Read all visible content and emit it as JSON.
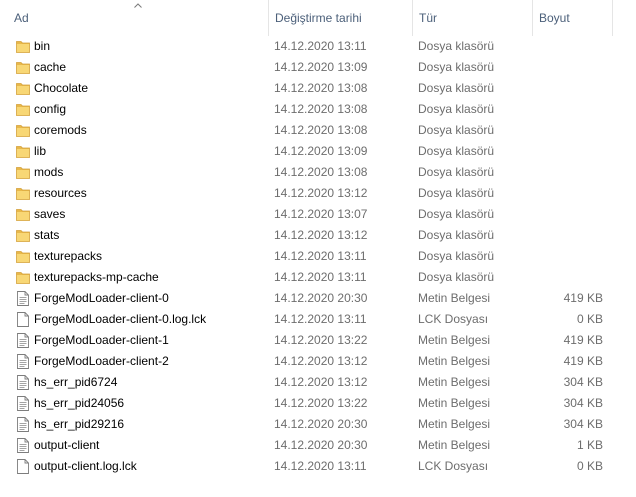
{
  "columns": {
    "name": "Ad",
    "date": "Değiştirme tarihi",
    "type": "Tür",
    "size": "Boyut"
  },
  "sort_icon": "chevron-up-icon",
  "files": [
    {
      "name": "bin",
      "date": "14.12.2020 13:11",
      "type": "Dosya klasörü",
      "size": "",
      "icon": "folder-icon"
    },
    {
      "name": "cache",
      "date": "14.12.2020 13:09",
      "type": "Dosya klasörü",
      "size": "",
      "icon": "folder-icon"
    },
    {
      "name": "Chocolate",
      "date": "14.12.2020 13:08",
      "type": "Dosya klasörü",
      "size": "",
      "icon": "folder-icon"
    },
    {
      "name": "config",
      "date": "14.12.2020 13:08",
      "type": "Dosya klasörü",
      "size": "",
      "icon": "folder-icon"
    },
    {
      "name": "coremods",
      "date": "14.12.2020 13:08",
      "type": "Dosya klasörü",
      "size": "",
      "icon": "folder-icon"
    },
    {
      "name": "lib",
      "date": "14.12.2020 13:09",
      "type": "Dosya klasörü",
      "size": "",
      "icon": "folder-icon"
    },
    {
      "name": "mods",
      "date": "14.12.2020 13:08",
      "type": "Dosya klasörü",
      "size": "",
      "icon": "folder-icon"
    },
    {
      "name": "resources",
      "date": "14.12.2020 13:12",
      "type": "Dosya klasörü",
      "size": "",
      "icon": "folder-icon"
    },
    {
      "name": "saves",
      "date": "14.12.2020 13:07",
      "type": "Dosya klasörü",
      "size": "",
      "icon": "folder-icon"
    },
    {
      "name": "stats",
      "date": "14.12.2020 13:12",
      "type": "Dosya klasörü",
      "size": "",
      "icon": "folder-icon"
    },
    {
      "name": "texturepacks",
      "date": "14.12.2020 13:11",
      "type": "Dosya klasörü",
      "size": "",
      "icon": "folder-icon"
    },
    {
      "name": "texturepacks-mp-cache",
      "date": "14.12.2020 13:11",
      "type": "Dosya klasörü",
      "size": "",
      "icon": "folder-icon"
    },
    {
      "name": "ForgeModLoader-client-0",
      "date": "14.12.2020 20:30",
      "type": "Metin Belgesi",
      "size": "419 KB",
      "icon": "text-file-icon"
    },
    {
      "name": "ForgeModLoader-client-0.log.lck",
      "date": "14.12.2020 13:11",
      "type": "LCK Dosyası",
      "size": "0 KB",
      "icon": "blank-file-icon"
    },
    {
      "name": "ForgeModLoader-client-1",
      "date": "14.12.2020 13:22",
      "type": "Metin Belgesi",
      "size": "419 KB",
      "icon": "text-file-icon"
    },
    {
      "name": "ForgeModLoader-client-2",
      "date": "14.12.2020 13:12",
      "type": "Metin Belgesi",
      "size": "419 KB",
      "icon": "text-file-icon"
    },
    {
      "name": "hs_err_pid6724",
      "date": "14.12.2020 13:12",
      "type": "Metin Belgesi",
      "size": "304 KB",
      "icon": "text-file-icon"
    },
    {
      "name": "hs_err_pid24056",
      "date": "14.12.2020 13:22",
      "type": "Metin Belgesi",
      "size": "304 KB",
      "icon": "text-file-icon"
    },
    {
      "name": "hs_err_pid29216",
      "date": "14.12.2020 20:30",
      "type": "Metin Belgesi",
      "size": "304 KB",
      "icon": "text-file-icon"
    },
    {
      "name": "output-client",
      "date": "14.12.2020 20:30",
      "type": "Metin Belgesi",
      "size": "1 KB",
      "icon": "text-file-icon"
    },
    {
      "name": "output-client.log.lck",
      "date": "14.12.2020 13:11",
      "type": "LCK Dosyası",
      "size": "0 KB",
      "icon": "blank-file-icon"
    }
  ]
}
